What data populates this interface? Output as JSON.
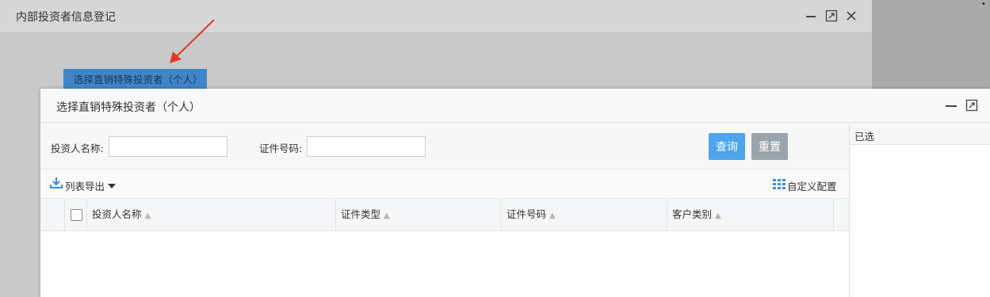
{
  "outer_window": {
    "title": "内部投资者信息登记",
    "corner_text": "•"
  },
  "trigger_button": {
    "label": "选择直销特殊投资者（个人）"
  },
  "modal": {
    "title": "选择直销特殊投资者（个人）",
    "filters": {
      "investor_name_label": "投资人名称:",
      "investor_name_value": "",
      "id_number_label": "证件号码:",
      "id_number_value": ""
    },
    "buttons": {
      "query": "查询",
      "reset": "重置"
    },
    "toolbar": {
      "export": "列表导出",
      "custom_config": "自定义配置"
    },
    "table": {
      "columns": [
        "投资人名称",
        "证件类型",
        "证件号码",
        "客户类别"
      ],
      "rows": []
    },
    "selected_panel": {
      "title": "已选"
    }
  },
  "colors": {
    "query_button": "#4ea5ee",
    "reset_button": "#9aa4ad",
    "trigger_button": "#3f86c9",
    "arrow": "#e23a2a",
    "icon_blue": "#3c8fdc"
  }
}
